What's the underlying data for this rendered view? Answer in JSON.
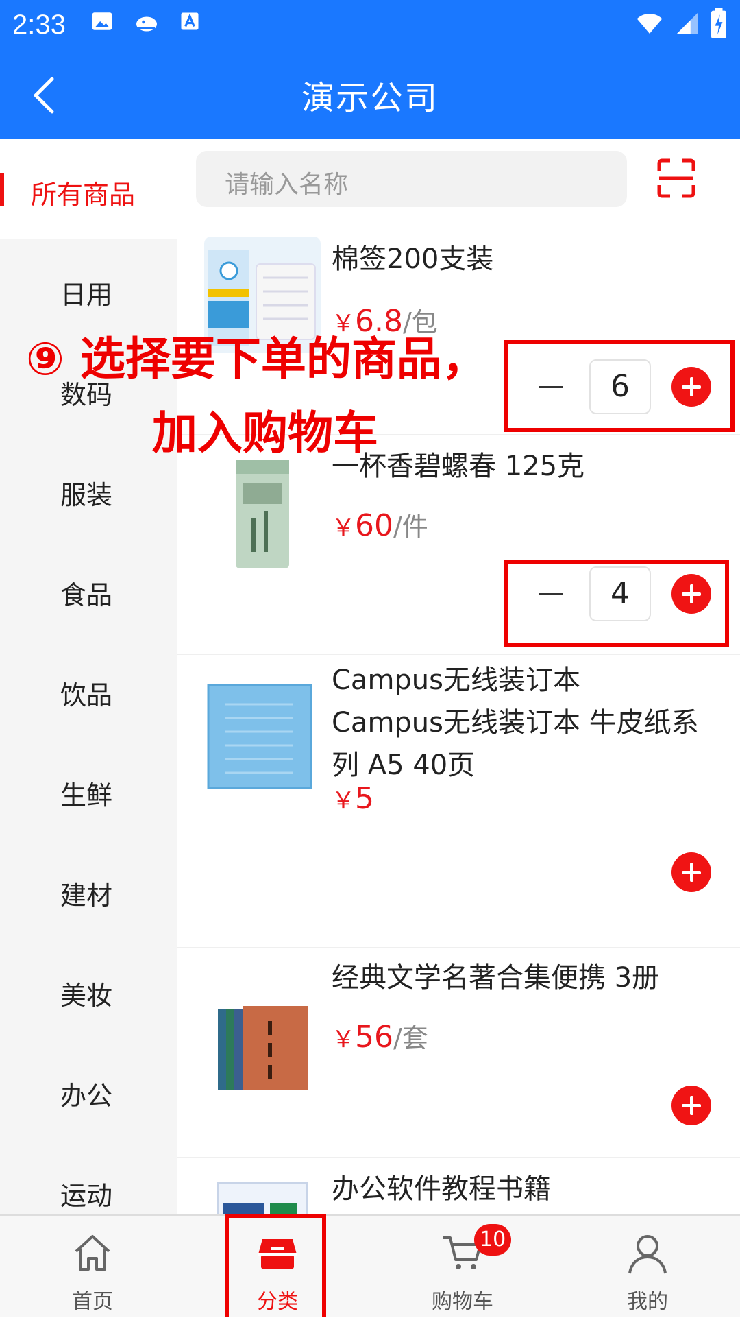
{
  "status": {
    "time": "2:33"
  },
  "header": {
    "title": "演示公司"
  },
  "search": {
    "placeholder": "请输入名称"
  },
  "sidebar": {
    "items": [
      {
        "label": "所有商品",
        "active": true
      },
      {
        "label": "日用"
      },
      {
        "label": "数码"
      },
      {
        "label": "服装"
      },
      {
        "label": "食品"
      },
      {
        "label": "饮品"
      },
      {
        "label": "生鲜"
      },
      {
        "label": "建材"
      },
      {
        "label": "美妆"
      },
      {
        "label": "办公"
      },
      {
        "label": "运动"
      }
    ]
  },
  "products": [
    {
      "name": "棉签200支装",
      "price": "6.8",
      "unit": "/包",
      "qty": "6"
    },
    {
      "name": "一杯香碧螺春 125克",
      "price": "60",
      "unit": "/件",
      "qty": "4"
    },
    {
      "name": "Campus无线装订本",
      "desc": "Campus无线装订本 牛皮纸系列 A5 40页",
      "price": "5",
      "unit": ""
    },
    {
      "name": "经典文学名著合集便携 3册",
      "price": "56",
      "unit": "/套"
    },
    {
      "name": "办公软件教程书籍"
    }
  ],
  "currency": "￥",
  "annotation": {
    "line1": "⑨ 选择要下单的商品，",
    "line2": "加入购物车"
  },
  "tabs": [
    {
      "label": "首页",
      "icon": "home-icon"
    },
    {
      "label": "分类",
      "icon": "category-icon",
      "active": true
    },
    {
      "label": "购物车",
      "icon": "cart-icon",
      "badge": "10"
    },
    {
      "label": "我的",
      "icon": "user-icon"
    }
  ],
  "colors": {
    "brand": "#1a78ff",
    "accent": "#ee1111"
  }
}
